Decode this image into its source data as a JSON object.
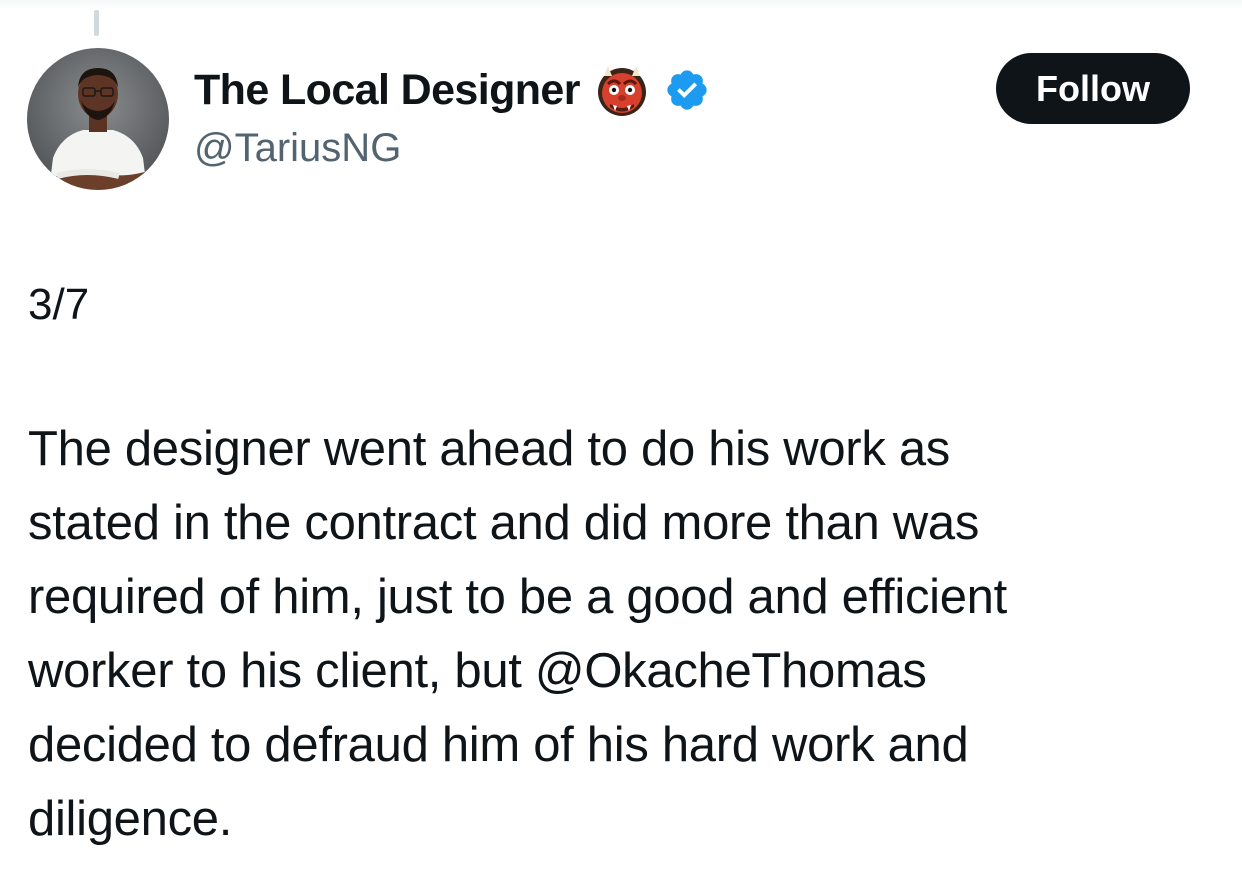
{
  "tweet": {
    "author": {
      "display_name": "The Local Designer",
      "emoji_icon": "ogre-emoji-icon",
      "verified_icon": "verified-badge-icon",
      "handle": "@TariusNG",
      "avatar_icon": "profile-photo-avatar"
    },
    "follow_label": "Follow",
    "thread_counter": "3/7",
    "text_lines": [
      "The designer went ahead to do his work as",
      "stated in the contract and did more than was",
      "required of him, just to be a good and efficient",
      "worker to his client, but @OkacheThomas",
      "decided to defraud him of his hard work and",
      "diligence."
    ]
  },
  "colors": {
    "text_primary": "#0f1419",
    "text_secondary": "#536471",
    "verified_blue": "#1d9bf0",
    "follow_button_bg": "#0f1419",
    "thread_line": "#cfd9de"
  }
}
